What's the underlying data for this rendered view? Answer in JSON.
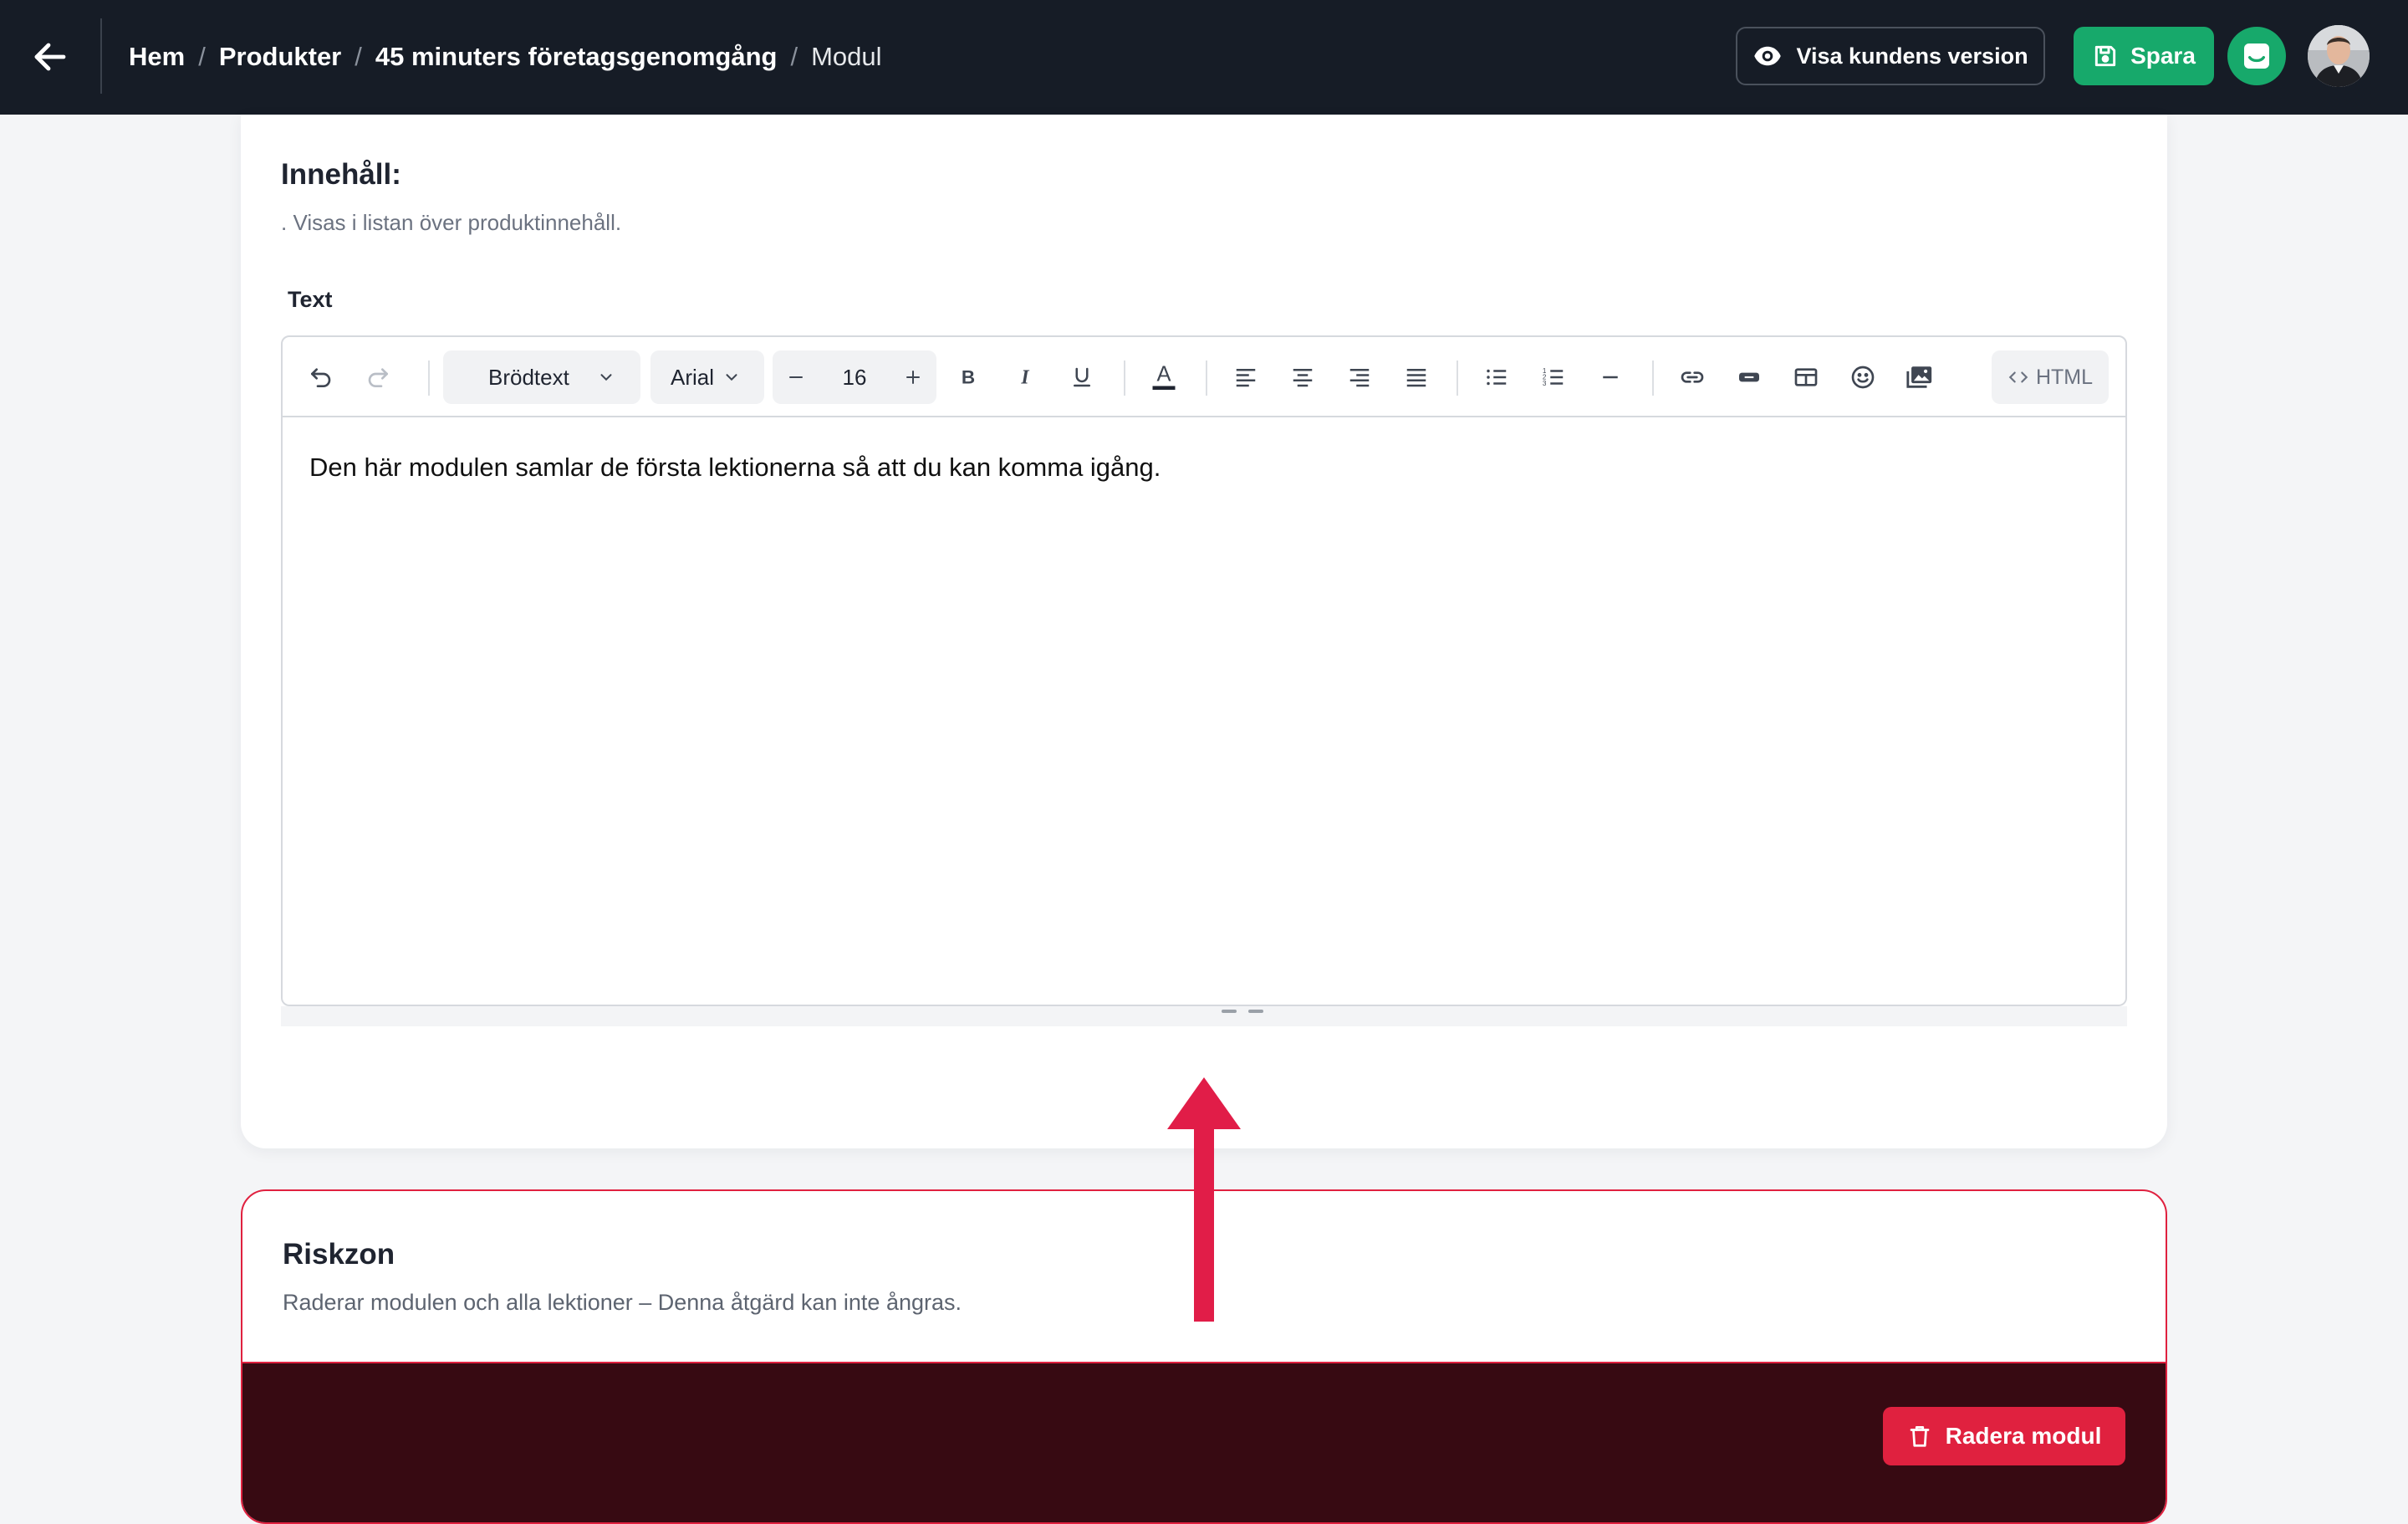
{
  "header": {
    "breadcrumb": {
      "home": "Hem",
      "products": "Produkter",
      "product": "45 minuters företagsgenomgång",
      "current": "Modul",
      "separator": "/"
    },
    "preview_button": "Visa kundens version",
    "save_button": "Spara",
    "icons": [
      "arrow-left-icon",
      "eye-icon",
      "save-icon",
      "chat-icon"
    ]
  },
  "content": {
    "title": "Innehåll:",
    "description": ". Visas i listan över produktinnehåll.",
    "field_label": "Text",
    "editor": {
      "block_style": "Brödtext",
      "font_family": "Arial",
      "font_size": "16",
      "html_button": "HTML",
      "body_text": "Den här modulen samlar de första lektionerna så att du kan komma igång.",
      "toolbar_icons": [
        "undo-icon",
        "redo-icon",
        "bold-icon",
        "italic-icon",
        "underline-icon",
        "text-color-icon",
        "align-left-icon",
        "align-center-icon",
        "align-right-icon",
        "align-justify-icon",
        "bullet-list-icon",
        "numbered-list-icon",
        "horizontal-rule-icon",
        "link-icon",
        "button-icon",
        "table-icon",
        "emoji-icon",
        "image-icon",
        "code-icon"
      ]
    }
  },
  "danger_zone": {
    "title": "Riskzon",
    "description": "Raderar modulen och alla lektioner – Denna åtgärd kan inte ångras.",
    "delete_button": "Radera modul"
  },
  "colors": {
    "header_bg": "#161c26",
    "accent_green": "#17a96b",
    "danger_red": "#e0213f",
    "danger_footer_bg": "#370a12",
    "annotation_arrow": "#e11d48"
  }
}
